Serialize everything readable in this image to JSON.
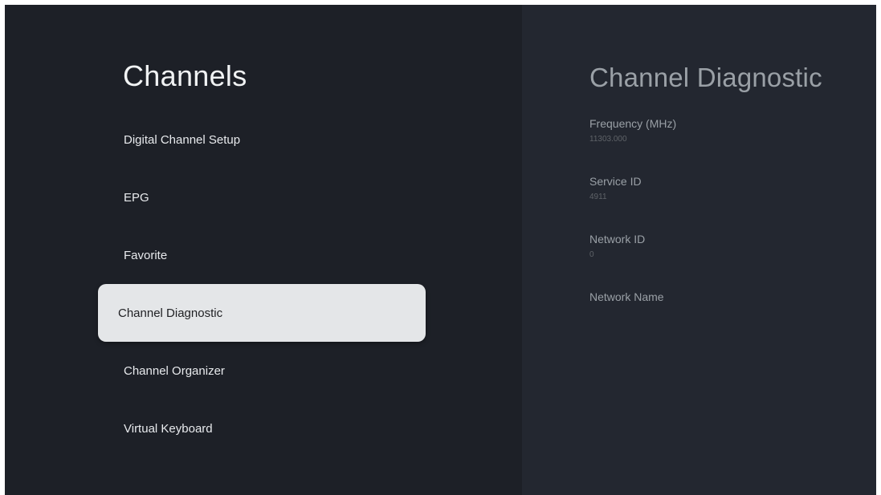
{
  "menu": {
    "title": "Channels",
    "items": [
      {
        "label": "Digital Channel Setup"
      },
      {
        "label": "EPG"
      },
      {
        "label": "Favorite"
      },
      {
        "label": "Channel Diagnostic",
        "selected": true
      },
      {
        "label": "Channel Organizer"
      },
      {
        "label": "Virtual Keyboard"
      }
    ]
  },
  "detail": {
    "title": "Channel Diagnostic",
    "fields": [
      {
        "label": "Frequency (MHz)",
        "value": "11303.000"
      },
      {
        "label": "Service ID",
        "value": "4911"
      },
      {
        "label": "Network ID",
        "value": "0"
      },
      {
        "label": "Network Name",
        "value": ""
      }
    ]
  }
}
